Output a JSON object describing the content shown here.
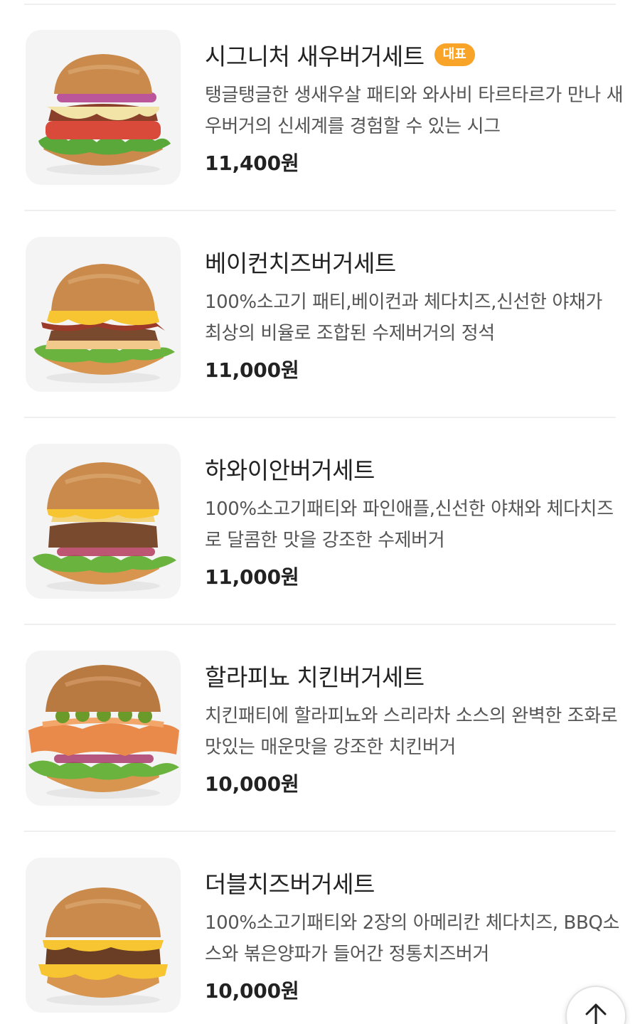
{
  "menu": {
    "items": [
      {
        "name": "시그니처 새우버거세트",
        "badge": "대표",
        "description": "탱글탱글한 생새우살 패티와 와사비 타르타르가 만나 새우버거의 신세계를 경험할 수 있는 시그",
        "price": "11,400원",
        "image": "shrimp-burger-image"
      },
      {
        "name": "베이컨치즈버거세트",
        "description": "100%소고기 패티,베이컨과 체다치즈,신선한 야채가 최상의 비율로 조합된 수제버거의 정석",
        "price": "11,000원",
        "image": "bacon-cheese-burger-image"
      },
      {
        "name": "하와이안버거세트",
        "description": "100%소고기패티와 파인애플,신선한 야채와 체다치즈로 달콤한 맛을 강조한 수제버거",
        "price": "11,000원",
        "image": "hawaiian-burger-image"
      },
      {
        "name": "할라피뇨 치킨버거세트",
        "description": "치킨패티에 할라피뇨와 스리라차 소스의 완벽한 조화로 맛있는 매운맛을 강조한 치킨버거",
        "price": "10,000원",
        "image": "jalapeno-chicken-burger-image"
      },
      {
        "name": "더블치즈버거세트",
        "description": "100%소고기패티와 2장의 아메리칸 체다치즈, BBQ소스와 볶은양파가 들어간 정통치즈버거",
        "price": "10,000원",
        "image": "double-cheese-burger-image"
      }
    ]
  },
  "colors": {
    "badge": "#f7a428",
    "price": "#222222",
    "description": "#555555",
    "divider": "#efefef"
  },
  "scroll_top": {
    "icon": "arrow-up-icon"
  }
}
